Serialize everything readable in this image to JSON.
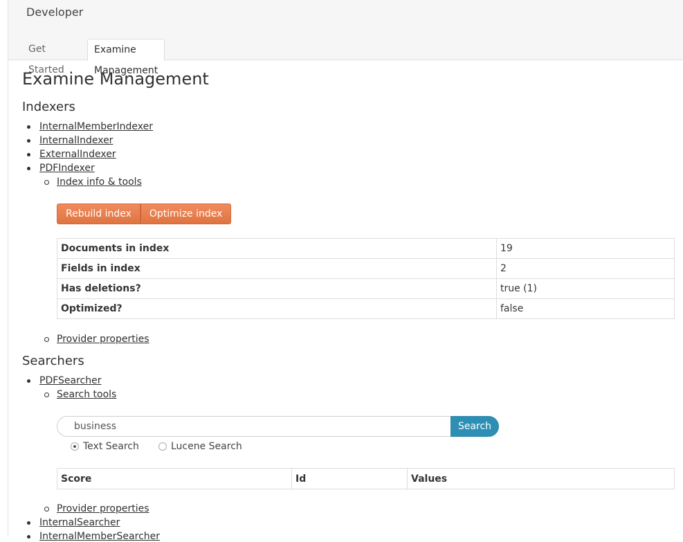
{
  "header": {
    "title": "Developer"
  },
  "tabs": [
    {
      "label": "Get Started",
      "active": false
    },
    {
      "label": "Examine Management",
      "active": true
    }
  ],
  "page": {
    "title": "Examine Management"
  },
  "indexers": {
    "heading": "Indexers",
    "items": [
      "InternalMemberIndexer",
      "InternalIndexer",
      "ExternalIndexer",
      "PDFIndexer"
    ],
    "expanded": {
      "info_tools_link": "Index info & tools",
      "buttons": {
        "rebuild": "Rebuild index",
        "optimize": "Optimize index"
      },
      "stats": [
        {
          "key": "Documents in index",
          "value": "19"
        },
        {
          "key": "Fields in index",
          "value": "2"
        },
        {
          "key": "Has deletions?",
          "value": "true (1)"
        },
        {
          "key": "Optimized?",
          "value": "false"
        }
      ],
      "provider_properties_link": "Provider properties"
    }
  },
  "searchers": {
    "heading": "Searchers",
    "expanded": {
      "name": "PDFSearcher",
      "search_tools_link": "Search tools",
      "search": {
        "value": "business",
        "button": "Search"
      },
      "options": [
        {
          "label": "Text Search",
          "selected": true
        },
        {
          "label": "Lucene Search",
          "selected": false
        }
      ],
      "result_columns": [
        "Score",
        "Id",
        "Values"
      ],
      "provider_properties_link": "Provider properties"
    },
    "other_items": [
      "InternalSearcher",
      "InternalMemberSearcher"
    ]
  },
  "colors": {
    "orange_button": "#e07440",
    "search_button": "#2d8fb3"
  }
}
